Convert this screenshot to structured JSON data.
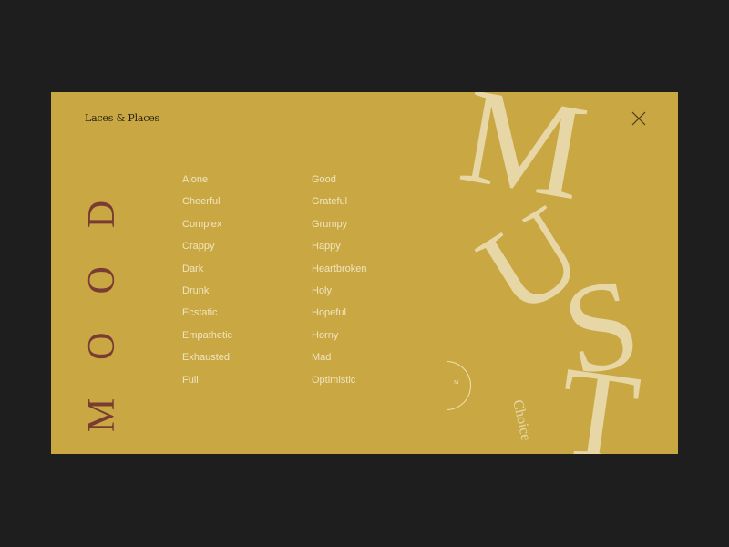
{
  "brand": "Laces & Places",
  "heading": "MOOD",
  "icons": {
    "close": "close-x-icon",
    "badge": "half-circle-badge"
  },
  "moods_col1": [
    "Alone",
    "Cheerful",
    "Complex",
    "Crappy",
    "Dark",
    "Drunk",
    "Ecstatic",
    "Empathetic",
    "Exhausted",
    "Full"
  ],
  "moods_col2": [
    "Good",
    "Grateful",
    "Grumpy",
    "Happy",
    "Heartbroken",
    "Holy",
    "Hopeful",
    "Horny",
    "Mad",
    "Optimistic"
  ],
  "feature": {
    "letters": [
      "M",
      "U",
      "S",
      "T"
    ],
    "subtitle": "Choice",
    "badge_letter": "M"
  },
  "colors": {
    "background": "#1e1e1e",
    "panel": "#c9a844",
    "heading": "#7a3b32",
    "list_text": "#f0e4bd",
    "display_text": "#e8d7a6"
  }
}
